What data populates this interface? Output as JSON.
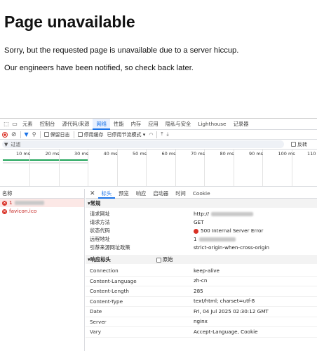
{
  "page": {
    "title": "Page unavailable",
    "p1": "Sorry, but the requested page is unavailable due to a server hiccup.",
    "p2": "Our engineers have been notified, so check back later."
  },
  "devtools": {
    "tabs": [
      "元素",
      "控制台",
      "源代码/来源",
      "网络",
      "性能",
      "内存",
      "应用",
      "隐私与安全",
      "Lighthouse",
      "记录器"
    ],
    "active_tab": "网络",
    "toolbar": {
      "preserve_log": "保留日志",
      "disable_cache": "停用缓存",
      "throttle": "已停用节流模式"
    },
    "filter": {
      "placeholder": "过滤",
      "invert": "反转"
    },
    "timeline": {
      "ticks": [
        "10 ms",
        "20 ms",
        "30 ms",
        "40 ms",
        "50 ms",
        "60 ms",
        "70 ms",
        "80 ms",
        "90 ms",
        "100 ms",
        "110 m"
      ]
    },
    "requests": {
      "header": "名称",
      "items": [
        {
          "name": "1",
          "blurred": true
        },
        {
          "name": "favicon.ico",
          "blurred": false
        }
      ]
    },
    "detail_tabs": [
      "标头",
      "预览",
      "响应",
      "启动器",
      "时间",
      "Cookie"
    ],
    "general": {
      "title": "▾常规",
      "rows": [
        {
          "k": "请求网址",
          "v": "http://"
        },
        {
          "k": "请求方法",
          "v": "GET"
        },
        {
          "k": "状态代码",
          "v": "500 Internal Server Error"
        },
        {
          "k": "远程地址",
          "v": "1"
        },
        {
          "k": "引荐来源网址政策",
          "v": "strict-origin-when-cross-origin"
        }
      ]
    },
    "response": {
      "title": "▾响应标头",
      "raw": "原始",
      "rows": [
        {
          "k": "Connection",
          "v": "keep-alive"
        },
        {
          "k": "Content-Language",
          "v": "zh-cn"
        },
        {
          "k": "Content-Length",
          "v": "285"
        },
        {
          "k": "Content-Type",
          "v": "text/html; charset=utf-8"
        },
        {
          "k": "Date",
          "v": "Fri, 04 Jul 2025 02:30:12 GMT"
        },
        {
          "k": "Server",
          "v": "nginx"
        },
        {
          "k": "Vary",
          "v": "Accept-Language, Cookie"
        }
      ]
    },
    "colors": {
      "accent": "#1a73e8",
      "error": "#d93025",
      "bar": "#21a45a"
    }
  }
}
